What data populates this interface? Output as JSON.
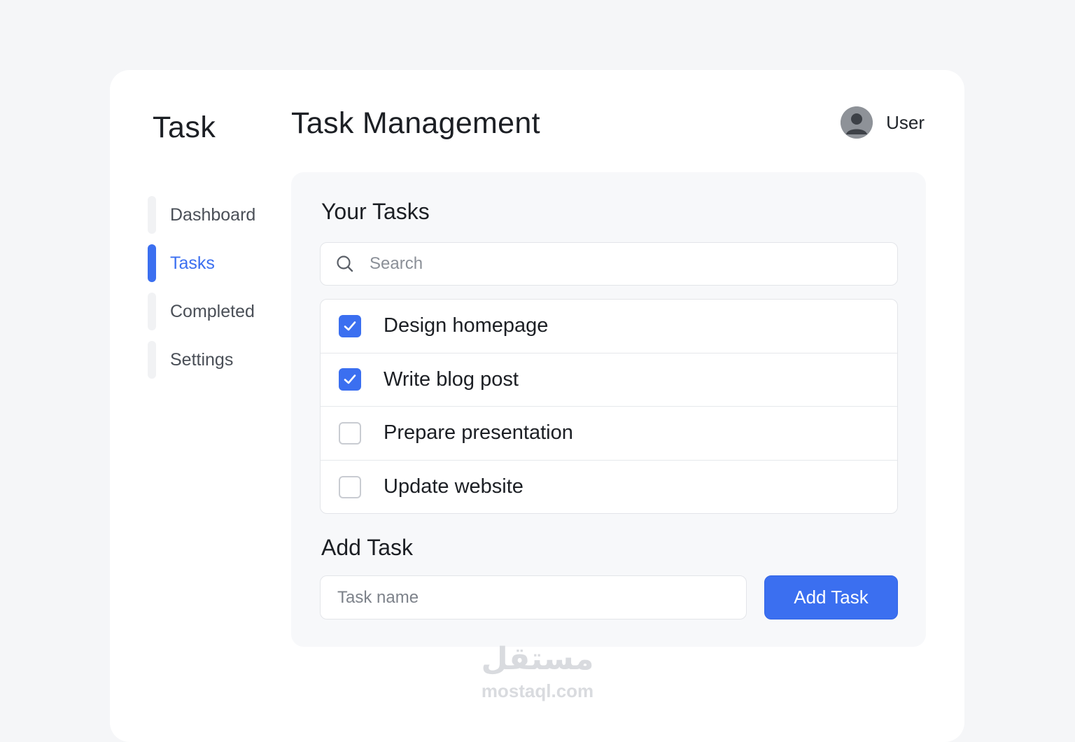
{
  "app": {
    "brand": "Task",
    "page_title": "Task Management"
  },
  "user": {
    "name": "User",
    "avatar_icon": "user-avatar-icon"
  },
  "sidebar": {
    "items": [
      {
        "label": "Dashboard",
        "active": false
      },
      {
        "label": "Tasks",
        "active": true
      },
      {
        "label": "Completed",
        "active": false
      },
      {
        "label": "Settings",
        "active": false
      }
    ]
  },
  "tasks_section": {
    "title": "Your Tasks",
    "search": {
      "placeholder": "Search",
      "value": "",
      "icon": "search-icon"
    },
    "items": [
      {
        "label": "Design homepage",
        "checked": true
      },
      {
        "label": "Write blog post",
        "checked": true
      },
      {
        "label": "Prepare presentation",
        "checked": false
      },
      {
        "label": "Update website",
        "checked": false
      }
    ]
  },
  "add_section": {
    "title": "Add Task",
    "input_placeholder": "Task name",
    "input_value": "",
    "button_label": "Add Task"
  },
  "watermark": {
    "arabic": "مستقل",
    "latin": "mostaql.com"
  },
  "colors": {
    "accent": "#3b6ff0",
    "background": "#f5f6f8",
    "card": "#ffffff",
    "panel": "#f7f8fa"
  }
}
